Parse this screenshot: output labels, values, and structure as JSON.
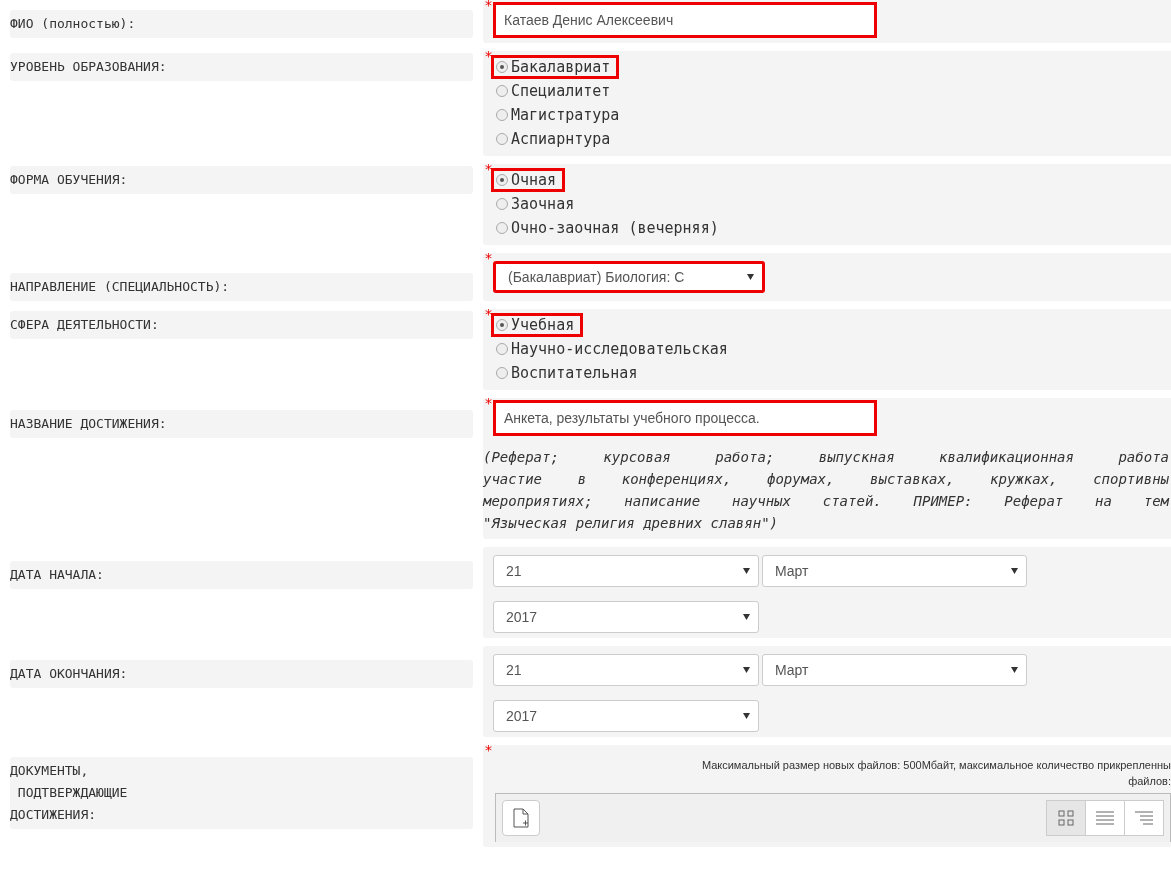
{
  "fields": [
    {
      "kind": "text",
      "label": "ФИО (полностью):",
      "required": "*",
      "value": "Катаев Денис Алексеевич",
      "highlighted": true
    },
    {
      "kind": "radio",
      "label": "УРОВЕНЬ ОБРАЗОВАНИЯ:",
      "required": "*",
      "options": [
        {
          "label": "Бакалавриат",
          "selected": true,
          "highlighted": true
        },
        {
          "label": "Специалитет",
          "selected": false,
          "highlighted": false
        },
        {
          "label": "Магистратура",
          "selected": false,
          "highlighted": false
        },
        {
          "label": "Аспиарнтура",
          "selected": false,
          "highlighted": false
        }
      ]
    },
    {
      "kind": "radio",
      "label": "ФОРМА ОБУЧЕНИЯ:",
      "required": "*",
      "options": [
        {
          "label": "Очная",
          "selected": true,
          "highlighted": true
        },
        {
          "label": "Заочная",
          "selected": false,
          "highlighted": false
        },
        {
          "label": "Очно-заочная (вечерняя)",
          "selected": false,
          "highlighted": false
        }
      ]
    },
    {
      "kind": "select",
      "label": "НАПРАВЛЕНИЕ (СПЕЦИАЛЬНОСТЬ):",
      "required": "*",
      "value": "(Бакалавриат) Биология: С",
      "highlighted": true
    },
    {
      "kind": "radio",
      "label": "СФЕРА ДЕЯТЕЛЬНОСТИ:",
      "required": "*",
      "options": [
        {
          "label": "Учебная",
          "selected": true,
          "highlighted": true
        },
        {
          "label": "Научно-исследовательская",
          "selected": false,
          "highlighted": false
        },
        {
          "label": "Воспитательная",
          "selected": false,
          "highlighted": false
        }
      ]
    },
    {
      "kind": "text",
      "label": "НАЗВАНИЕ ДОСТИЖЕНИЯ:",
      "required": "*",
      "value": "Анкета, результаты учебного процесса.",
      "highlighted": true,
      "hint_lines": [
        "(Реферат; курсовая  работа; выпускная квалификационная работа",
        "участие в конференциях, форумах, выставках, кружках, спортивны",
        "мероприятиях; написание научных статей. ПРИМЕР: Реферат на тем",
        "\"Языческая религия древних славян\")"
      ]
    },
    {
      "kind": "date",
      "label": "ДАТА НАЧАЛА:",
      "day": "21",
      "month": "Март",
      "year": "2017"
    },
    {
      "kind": "date",
      "label": "ДАТА ОКОНЧАНИЯ:",
      "day": "21",
      "month": "Март",
      "year": "2017"
    },
    {
      "kind": "files",
      "label": "ДОКУМЕНТЫ,\n ПОДТВЕРЖДАЮЩИЕ\nДОСТИЖЕНИЯ:",
      "required": "*",
      "note": "Максимальный размер новых файлов: 500Мбайт, максимальное количество прикрепленны",
      "note_2": "файлов:"
    }
  ]
}
